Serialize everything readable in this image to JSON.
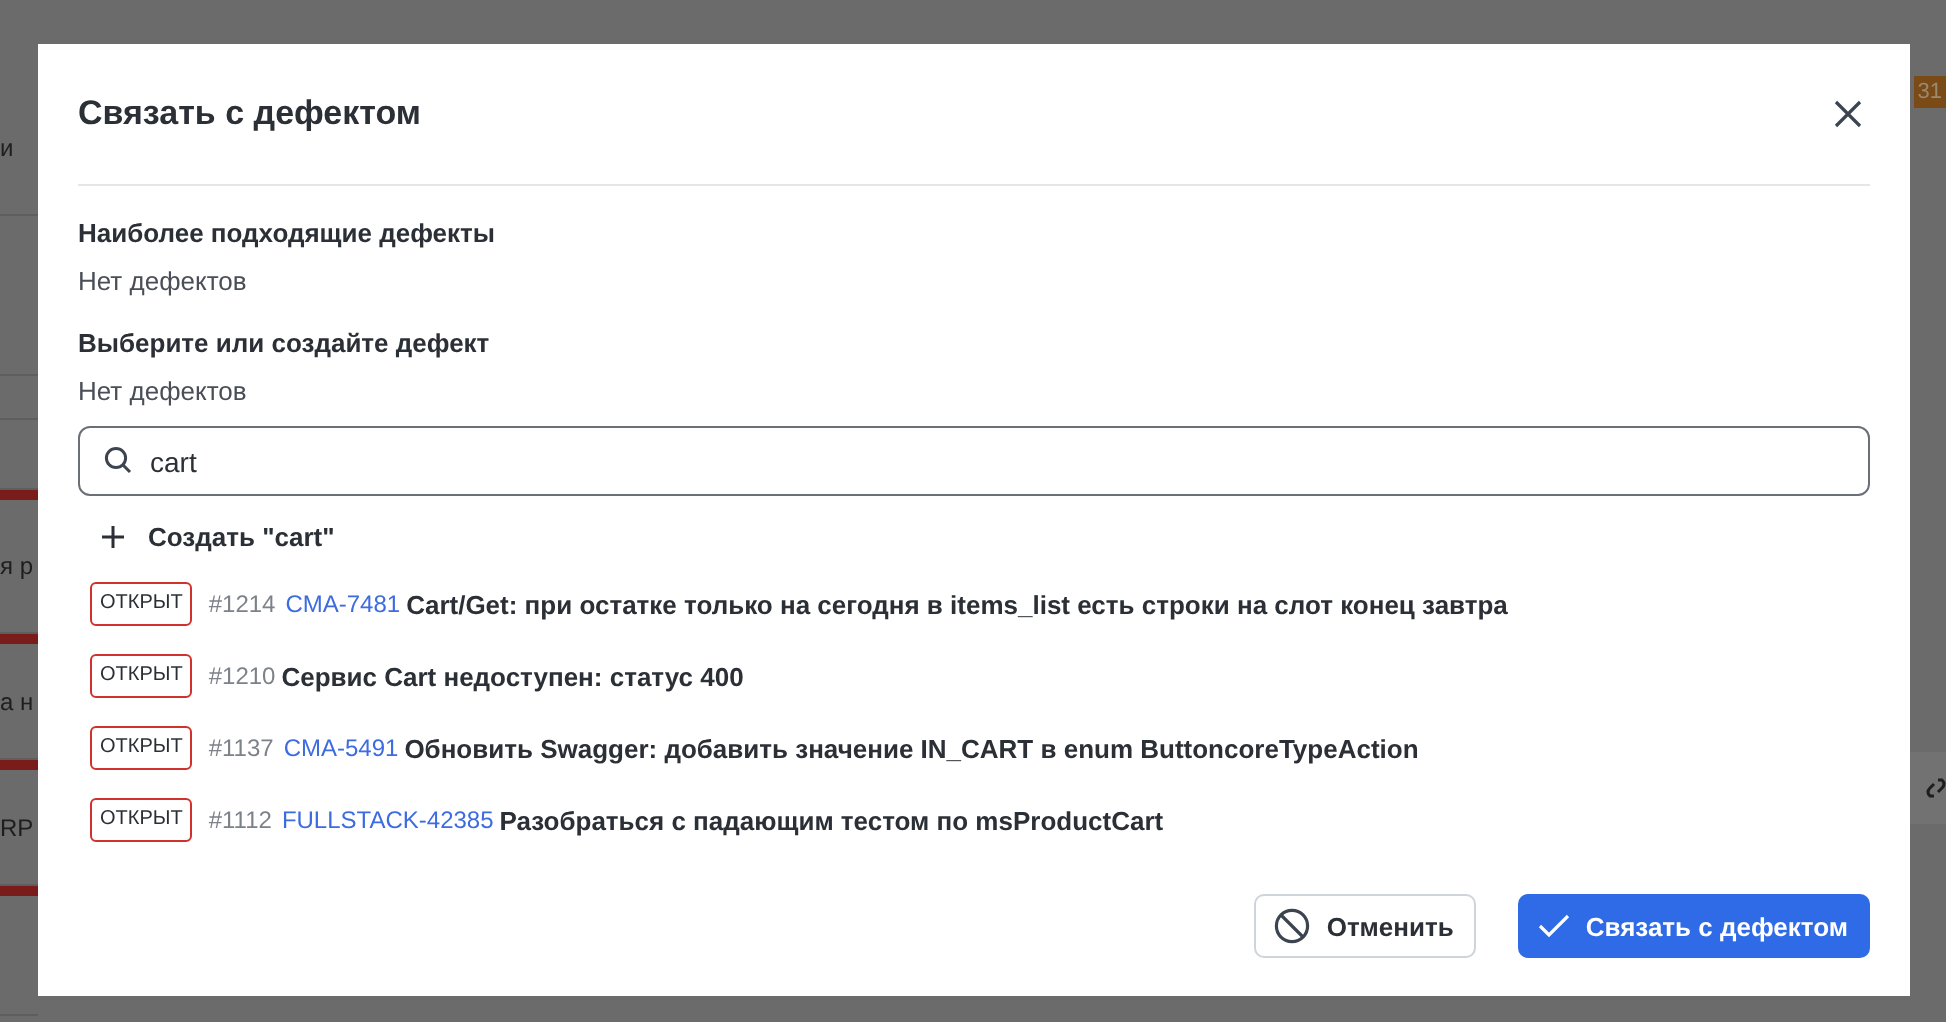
{
  "background": {
    "texts": [
      "и",
      "я р",
      "а н",
      "RP"
    ],
    "badge": "31"
  },
  "dialog": {
    "title": "Связать с дефектом",
    "sections": [
      {
        "heading": "Наиболее подходящие дефекты",
        "empty": "Нет дефектов"
      },
      {
        "heading": "Выберите или создайте дефект",
        "empty": "Нет дефектов"
      }
    ],
    "search": {
      "value": "cart"
    },
    "create": {
      "label": "Создать \"cart\""
    },
    "defects": [
      {
        "status": "ОТКРЫТ",
        "number": "#1214",
        "key": "CMA-7481",
        "title": "Cart/Get: при остатке только на сегодня в items_list есть строки на слот конец завтра"
      },
      {
        "status": "ОТКРЫТ",
        "number": "#1210",
        "title": "Сервис Cart недоступен: статус 400"
      },
      {
        "status": "ОТКРЫТ",
        "number": "#1137",
        "key": "CMA-5491",
        "title": "Обновить Swagger: добавить значение IN_CART в enum ButtoncoreTypeAction"
      },
      {
        "status": "ОТКРЫТ",
        "number": "#1112",
        "key": "FULLSTACK-42385",
        "title": "Разобраться с падающим тестом по msProductCart"
      }
    ],
    "buttons": [
      {
        "kind": "secondary",
        "label": "Отменить"
      },
      {
        "kind": "primary",
        "label": "Связать с дефектом"
      }
    ]
  }
}
